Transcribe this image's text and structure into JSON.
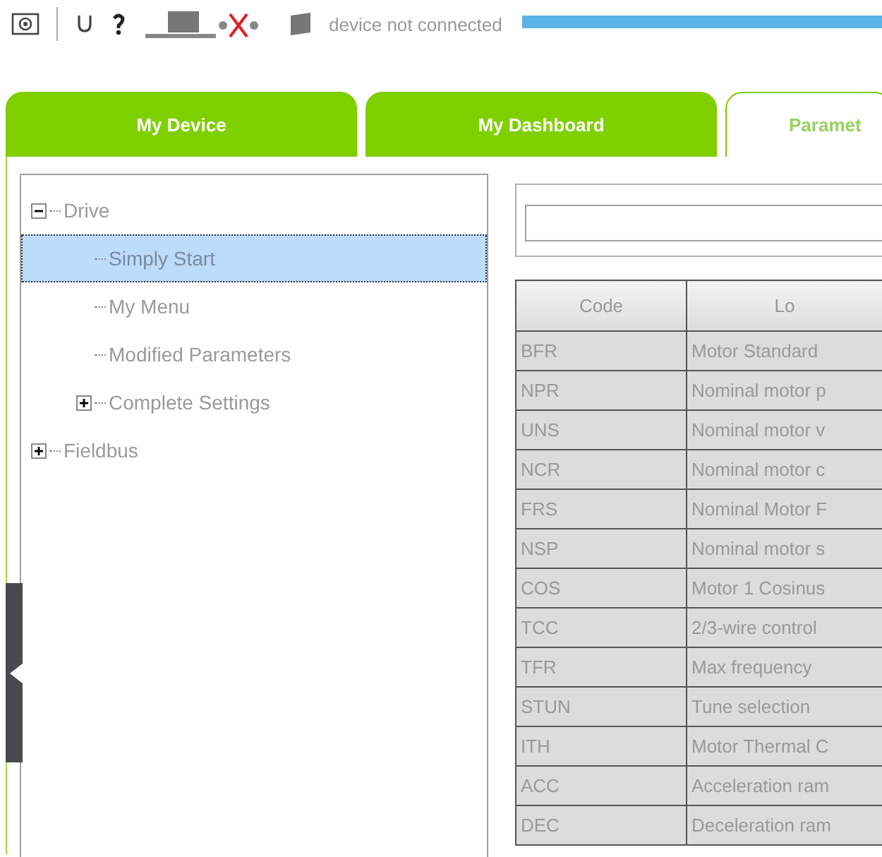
{
  "toolbar": {
    "status": "device not connected"
  },
  "tabs": [
    {
      "label": "My Device",
      "selected": false
    },
    {
      "label": "My Dashboard",
      "selected": false
    },
    {
      "label": "Paramet",
      "selected": true
    }
  ],
  "tree": [
    {
      "label": "Drive",
      "expanded": true,
      "selected": false,
      "children": [
        {
          "label": "Simply Start",
          "selected": true
        },
        {
          "label": "My Menu",
          "selected": false
        },
        {
          "label": "Modified Parameters",
          "selected": false
        },
        {
          "label": "Complete Settings",
          "expanded": false,
          "selected": false
        }
      ]
    },
    {
      "label": "Fieldbus",
      "expanded": false,
      "selected": false
    }
  ],
  "table": {
    "columns": [
      "Code",
      "Lo"
    ],
    "rows": [
      [
        "BFR",
        "Motor Standard"
      ],
      [
        "NPR",
        "Nominal motor p"
      ],
      [
        "UNS",
        "Nominal motor v"
      ],
      [
        "NCR",
        "Nominal motor c"
      ],
      [
        "FRS",
        "Nominal Motor F"
      ],
      [
        "NSP",
        "Nominal motor s"
      ],
      [
        "COS",
        "Motor 1 Cosinus"
      ],
      [
        "TCC",
        "2/3-wire control"
      ],
      [
        "TFR",
        "Max frequency"
      ],
      [
        "STUN",
        "Tune selection"
      ],
      [
        "ITH",
        "Motor Thermal C"
      ],
      [
        "ACC",
        "Acceleration ram"
      ],
      [
        "DEC",
        "Deceleration ram"
      ]
    ]
  }
}
